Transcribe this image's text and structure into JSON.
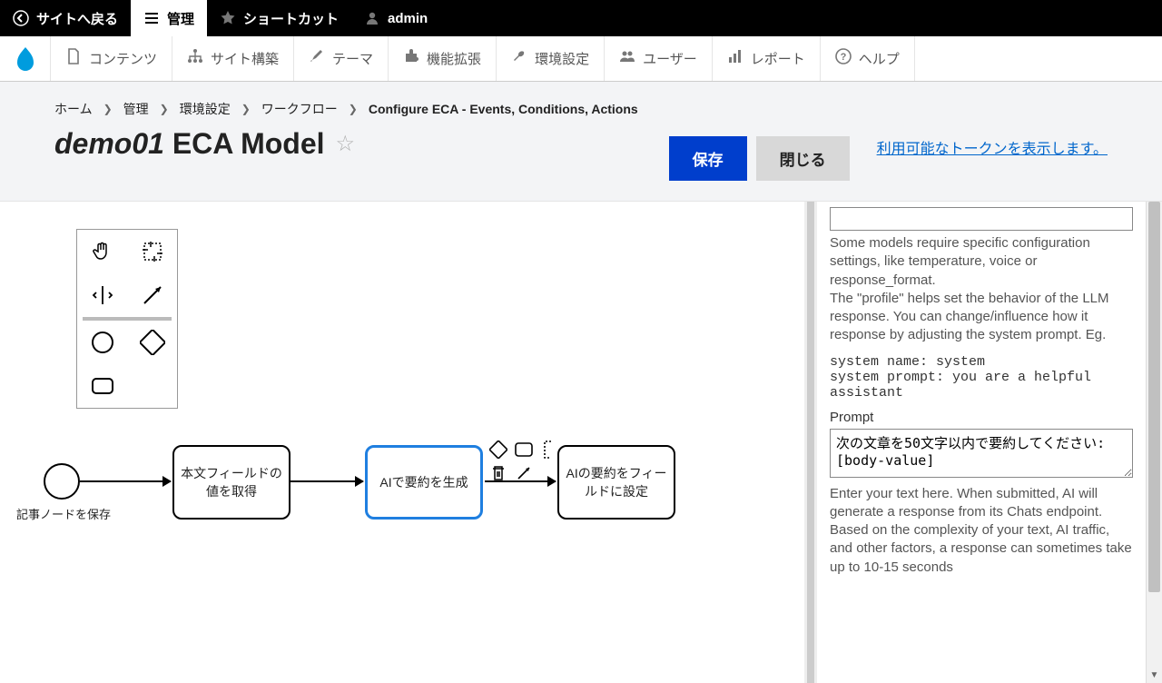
{
  "toolbar": {
    "back": "サイトへ戻る",
    "manage": "管理",
    "shortcuts": "ショートカット",
    "user": "admin"
  },
  "admin_menu": {
    "content": "コンテンツ",
    "structure": "サイト構築",
    "appearance": "テーマ",
    "extend": "機能拡張",
    "config": "環境設定",
    "people": "ユーザー",
    "reports": "レポート",
    "help": "ヘルプ"
  },
  "breadcrumb": {
    "home": "ホーム",
    "admin": "管理",
    "config": "環境設定",
    "workflow": "ワークフロー",
    "current": "Configure ECA - Events, Conditions, Actions"
  },
  "page": {
    "title_italic": "demo01",
    "title_rest": " ECA Model",
    "save": "保存",
    "close": "閉じる",
    "token_link": "利用可能なトークンを表示します。"
  },
  "diagram": {
    "event_label": "記事ノードを保存",
    "task1": "本文フィールドの値を取得",
    "task2": "AIで要約を生成",
    "task3": "AIの要約をフィールドに設定"
  },
  "panel": {
    "help1": "Some models require specific configuration settings, like temperature, voice or response_format.",
    "help2": "The \"profile\" helps set the behavior of the LLM response. You can change/influence how it response by adjusting the system prompt. Eg.",
    "mono": "system name: system\nsystem prompt: you are a helpful assistant",
    "prompt_label": "Prompt",
    "prompt_value": "次の文章を50文字以内で要約してください: [body-value]",
    "prompt_help": "Enter your text here. When submitted, AI will generate a response from its Chats endpoint. Based on the complexity of your text, AI traffic, and other factors, a response can sometimes take up to 10-15 seconds"
  }
}
